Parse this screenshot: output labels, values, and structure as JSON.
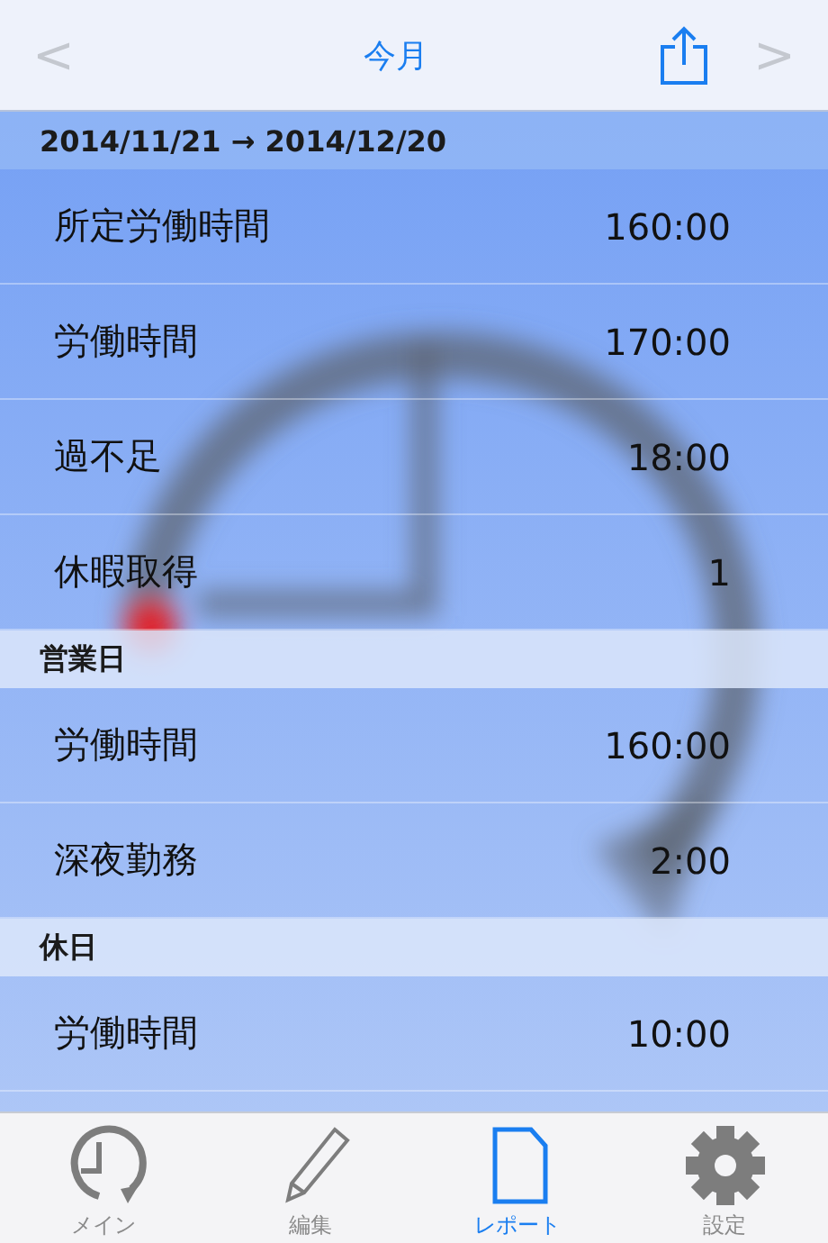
{
  "nav_bar": {
    "title": "今月",
    "back": "<",
    "forward": ">"
  },
  "sections": [
    {
      "kind": "range",
      "title": "2014/11/21 → 2014/12/20",
      "rows": [
        {
          "label": "所定労働時間",
          "value": "160:00"
        },
        {
          "label": "労働時間",
          "value": "170:00"
        },
        {
          "label": "過不足",
          "value": "18:00"
        },
        {
          "label": "休暇取得",
          "value": "1"
        }
      ]
    },
    {
      "kind": "group",
      "title": "営業日",
      "rows": [
        {
          "label": "労働時間",
          "value": "160:00"
        },
        {
          "label": "深夜勤務",
          "value": "2:00"
        }
      ]
    },
    {
      "kind": "group",
      "title": "休日",
      "rows": [
        {
          "label": "労働時間",
          "value": "10:00"
        }
      ]
    }
  ],
  "tab_bar": [
    {
      "label": "メイン",
      "kind": "clock",
      "selected": false
    },
    {
      "label": "編集",
      "kind": "pencil",
      "selected": false
    },
    {
      "label": "レポート",
      "kind": "document",
      "selected": true
    },
    {
      "label": "設定",
      "kind": "gear",
      "selected": false
    }
  ]
}
